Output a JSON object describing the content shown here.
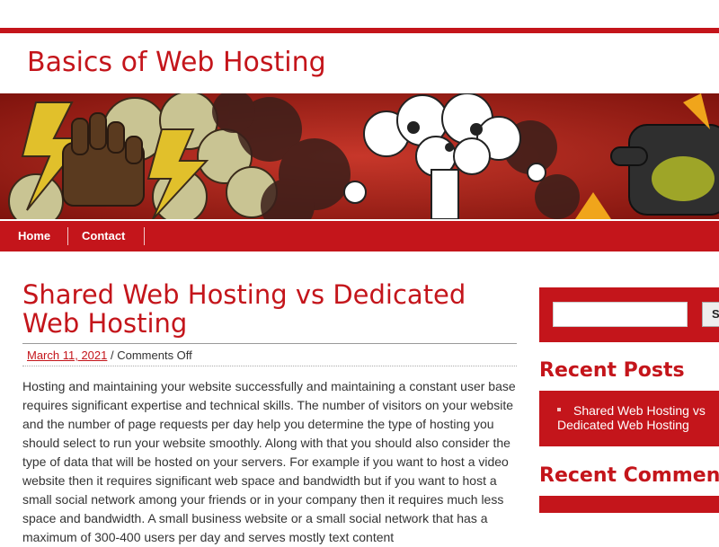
{
  "site": {
    "title": "Basics of Web Hosting"
  },
  "nav": {
    "items": [
      {
        "label": "Home"
      },
      {
        "label": "Contact"
      }
    ]
  },
  "post": {
    "title": "Shared Web Hosting vs Dedicated Web Hosting",
    "date": "March 11, 2021",
    "meta_separator": " / ",
    "comments": "Comments Off",
    "body": "Hosting and maintaining your website successfully and maintaining a constant user base requires significant expertise and technical skills. The number of visitors on your website and the number of page requests per day help you determine the type of hosting you should select to run your website smoothly. Along with that you should also consider the type of data that will be hosted on your servers. For example if you want to host a video website then it requires significant web space and bandwidth but if you want to host a small social network among your friends or in your company then it requires much less space and bandwidth. A small business website or a small social network that has a maximum of 300-400 users per day and serves mostly text content"
  },
  "sidebar": {
    "search": {
      "input_value": "",
      "button_label": "Search"
    },
    "recent_posts": {
      "title": "Recent Posts",
      "items": [
        {
          "label": "Shared Web Hosting vs Dedicated Web Hosting"
        }
      ]
    },
    "recent_comments": {
      "title": "Recent Comments"
    }
  },
  "colors": {
    "accent": "#c4151b",
    "text": "#333333",
    "background": "#ffffff"
  },
  "banner": {
    "icons": [
      "fist-icon",
      "lightning-icon",
      "mushroom-cloud-icon",
      "smoke-cloud-icon"
    ]
  }
}
